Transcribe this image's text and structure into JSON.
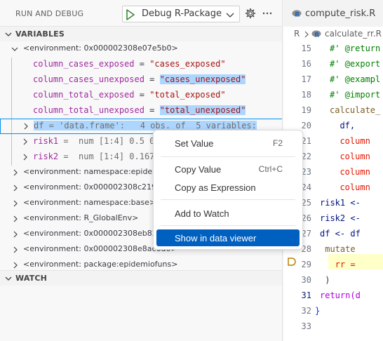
{
  "toolbar": {
    "title": "RUN AND DEBUG",
    "config": "Debug R-Package"
  },
  "sections": {
    "variables": "VARIABLES",
    "watch": "WATCH"
  },
  "variables": {
    "env_main": "<environment: 0x000002308e07e5b0>",
    "rows": [
      {
        "name": "column_cases_exposed",
        "eq": " = ",
        "value": "\"cases_exposed\""
      },
      {
        "name": "column_cases_unexposed",
        "eq": " = ",
        "value": "\"cases_unexposed\""
      },
      {
        "name": "column_total_exposed",
        "eq": " = ",
        "value": "\"total_exposed\""
      },
      {
        "name": "column_total_unexposed",
        "eq": " = ",
        "value": "\"total_unexposed\""
      }
    ],
    "df_row": "df = 'data.frame':   4 obs. of  5 variables:",
    "risk1_name": "risk1",
    "risk1_value": " =  num [1:4] 0.5 0",
    "risk2_name": "risk2",
    "risk2_value": " =  num [1:4] 0.167",
    "environments": [
      "<environment: namespace:epidemio",
      "<environment: 0x000002308c21918",
      "<environment: namespace:base>",
      "<environment: R_GlobalEnv>",
      "<environment: 0x000002308eb82b2",
      "<environment: 0x000002308e8ac6d0>",
      "<environment: package:epidemiofuns>"
    ]
  },
  "context_menu": {
    "set_value": "Set Value",
    "set_value_shortcut": "F2",
    "copy_value": "Copy Value",
    "copy_value_shortcut": "Ctrl+C",
    "copy_as_expression": "Copy as Expression",
    "add_to_watch": "Add to Watch",
    "show_in_data_viewer": "Show in data viewer"
  },
  "editor": {
    "tab_label": "compute_risk.R",
    "breadcrumb_root": "R",
    "breadcrumb_fn": "calculate_rr.R",
    "lines": [
      {
        "num": "15",
        "code": "#' @return",
        "cls": "c-comment"
      },
      {
        "num": "16",
        "code": "#' @export",
        "cls": "c-comment"
      },
      {
        "num": "17",
        "code": "#' @exampl",
        "cls": "c-comment"
      },
      {
        "num": "18",
        "code": "#' @import",
        "cls": "c-comment"
      },
      {
        "num": "19",
        "code": "calculate_",
        "cls": "c-fn",
        "indent": 0
      },
      {
        "num": "20",
        "code": "  df,",
        "cls": "c-var"
      },
      {
        "num": "21",
        "code": "  column",
        "cls": "c-red"
      },
      {
        "num": "22",
        "code": "  column",
        "cls": "c-red"
      },
      {
        "num": "23",
        "code": "  column",
        "cls": "c-red"
      },
      {
        "num": "24",
        "code": "  column",
        "cls": "c-red"
      },
      {
        "num": "25",
        "code": "risk1 <-",
        "cls": "c-var",
        "indent": -1
      },
      {
        "num": "26",
        "code": "risk2 <-",
        "cls": "c-var",
        "indent": -1
      },
      {
        "num": "27",
        "code": "df <- df",
        "cls": "c-var",
        "indent": -1
      },
      {
        "num": "28",
        "code": " mutate",
        "cls": "c-fn",
        "indent": -1
      },
      {
        "num": "29",
        "code": "   rr =",
        "cls": "c-red",
        "indent": -1
      },
      {
        "num": "30",
        "code": " )",
        "cls": "c-plain",
        "indent": -1
      },
      {
        "num": "31",
        "code": "return(d",
        "cls": "c-kw",
        "indent": -1
      },
      {
        "num": "32",
        "code": "}",
        "cls": "c-brace",
        "indent": -2
      },
      {
        "num": "33",
        "code": "",
        "cls": "c-plain"
      }
    ],
    "current_line": "31"
  },
  "colors": {
    "accent": "#0060c0",
    "highlight": "#add6ff",
    "current_line": "#ffffc8",
    "breakpoint": "#be8100"
  }
}
